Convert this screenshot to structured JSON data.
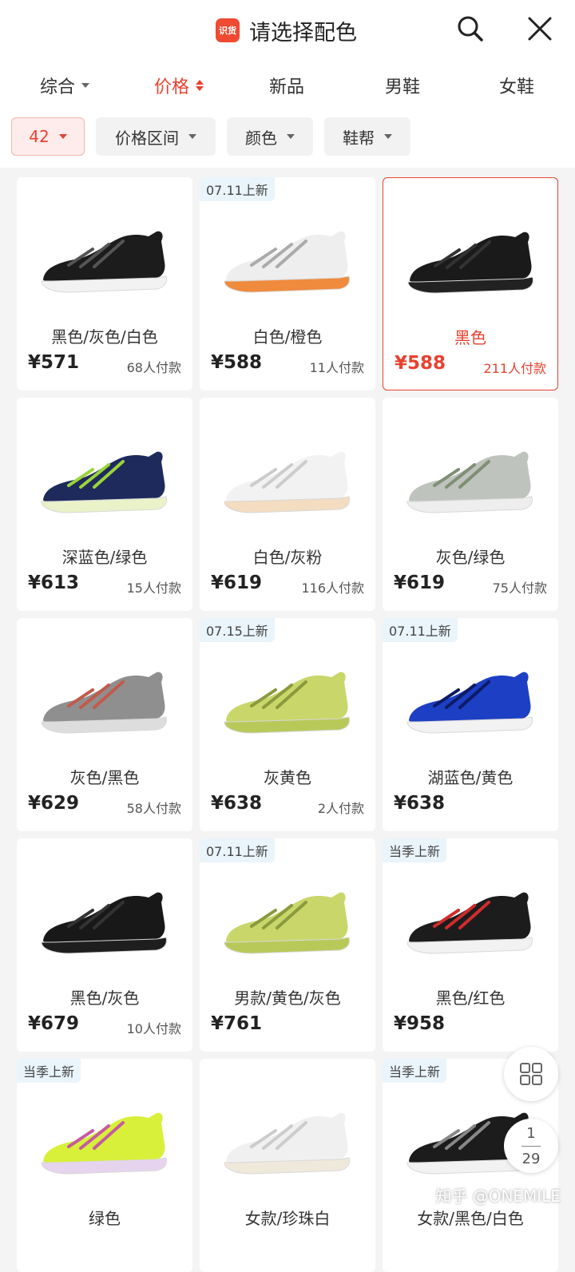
{
  "header": {
    "app_badge": "识货",
    "title": "请选择配色",
    "search_icon": "search-icon",
    "close_icon": "close-icon"
  },
  "sort_tabs": [
    {
      "label": "综合",
      "active": false
    },
    {
      "label": "价格",
      "active": true
    },
    {
      "label": "新品",
      "active": false
    },
    {
      "label": "男鞋",
      "active": false
    },
    {
      "label": "女鞋",
      "active": false
    }
  ],
  "filters": [
    {
      "label": "42",
      "active": true
    },
    {
      "label": "价格区间",
      "active": false
    },
    {
      "label": "颜色",
      "active": false
    },
    {
      "label": "鞋帮",
      "active": false
    }
  ],
  "colors": {
    "accent": "#e8412f",
    "badge_bg": "#eaf4fb"
  },
  "products": [
    {
      "badge": "",
      "color": "黑色/灰色/白色",
      "price": "¥571",
      "buyers": "68人付款",
      "selected": false,
      "upper": "#1c1c1c",
      "accent": "#555555",
      "sole": "#f2f2f2"
    },
    {
      "badge": "07.11上新",
      "color": "白色/橙色",
      "price": "¥588",
      "buyers": "11人付款",
      "selected": false,
      "upper": "#eeeeee",
      "accent": "#aaaaaa",
      "sole": "#f08a3c"
    },
    {
      "badge": "",
      "color": "黑色",
      "price": "¥588",
      "buyers": "211人付款",
      "selected": true,
      "upper": "#1a1a1a",
      "accent": "#333333",
      "sole": "#222222"
    },
    {
      "badge": "",
      "color": "深蓝色/绿色",
      "price": "¥613",
      "buyers": "15人付款",
      "selected": false,
      "upper": "#1e2a5c",
      "accent": "#9bd43a",
      "sole": "#e9f2c8"
    },
    {
      "badge": "",
      "color": "白色/灰粉",
      "price": "¥619",
      "buyers": "116人付款",
      "selected": false,
      "upper": "#f2f2f2",
      "accent": "#cccccc",
      "sole": "#f3dcc0"
    },
    {
      "badge": "",
      "color": "灰色/绿色",
      "price": "¥619",
      "buyers": "75人付款",
      "selected": false,
      "upper": "#bfc3bd",
      "accent": "#7f8f76",
      "sole": "#eeeeee"
    },
    {
      "badge": "",
      "color": "灰色/黑色",
      "price": "¥629",
      "buyers": "58人付款",
      "selected": false,
      "upper": "#8f8f8f",
      "accent": "#c25a4a",
      "sole": "#dddddd"
    },
    {
      "badge": "07.15上新",
      "color": "灰黄色",
      "price": "¥638",
      "buyers": "2人付款",
      "selected": false,
      "upper": "#c9d66a",
      "accent": "#8a9a3c",
      "sole": "#b8c95a"
    },
    {
      "badge": "07.11上新",
      "color": "湖蓝色/黄色",
      "price": "¥638",
      "buyers": "",
      "selected": false,
      "upper": "#1d3fc4",
      "accent": "#0d1a66",
      "sole": "#f2f2f2"
    },
    {
      "badge": "",
      "color": "黑色/灰色",
      "price": "¥679",
      "buyers": "10人付款",
      "selected": false,
      "upper": "#181818",
      "accent": "#333333",
      "sole": "#1e1e1e"
    },
    {
      "badge": "07.11上新",
      "color": "男款/黄色/灰色",
      "price": "¥761",
      "buyers": "",
      "selected": false,
      "upper": "#c9d66a",
      "accent": "#8a9a3c",
      "sole": "#b8c95a"
    },
    {
      "badge": "当季上新",
      "color": "黑色/红色",
      "price": "¥958",
      "buyers": "",
      "selected": false,
      "upper": "#1c1c1c",
      "accent": "#d12c2c",
      "sole": "#f2f2f2"
    },
    {
      "badge": "当季上新",
      "color": "绿色",
      "price": "",
      "buyers": "",
      "selected": false,
      "upper": "#d8f03a",
      "accent": "#c45aa0",
      "sole": "#e6d4ef"
    },
    {
      "badge": "",
      "color": "女款/珍珠白",
      "price": "",
      "buyers": "",
      "selected": false,
      "upper": "#f0f0f0",
      "accent": "#cccccc",
      "sole": "#efe9dc"
    },
    {
      "badge": "当季上新",
      "color": "女款/黑色/白色",
      "price": "",
      "buyers": "",
      "selected": false,
      "upper": "#1c1c1c",
      "accent": "#888888",
      "sole": "#f2f2f2"
    }
  ],
  "float_grid_icon": "grid-view-icon",
  "pager": {
    "current": "1",
    "total": "29"
  },
  "watermark": "知乎 @ONEMILE"
}
